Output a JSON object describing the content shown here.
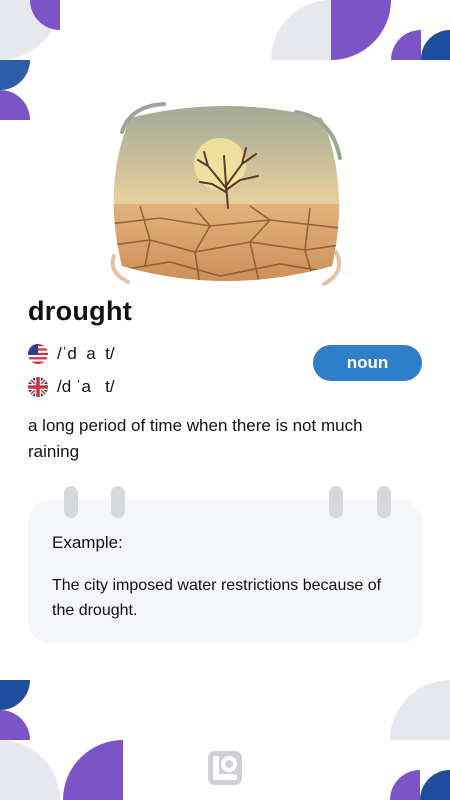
{
  "word": "drought",
  "pronunciations": [
    {
      "region": "US",
      "flag": "us-flag-icon",
      "ipa": "/ˈd  a  t/"
    },
    {
      "region": "UK",
      "flag": "uk-flag-icon",
      "ipa": "/d ˈa   t/"
    }
  ],
  "part_of_speech": "noun",
  "definition": "a long period of time when there is not much raining",
  "example": {
    "label": "Example:",
    "text": "The city imposed water restrictions because of the drought."
  },
  "illustration": "dry-cracked-earth-tree-illustration",
  "colors": {
    "accent_blue": "#2f7fc8",
    "deco_purple": "#7d54c7",
    "deco_blue": "#1d4d9c",
    "deco_gray": "#e6e8ee",
    "card_bg": "#f5f6fa"
  }
}
